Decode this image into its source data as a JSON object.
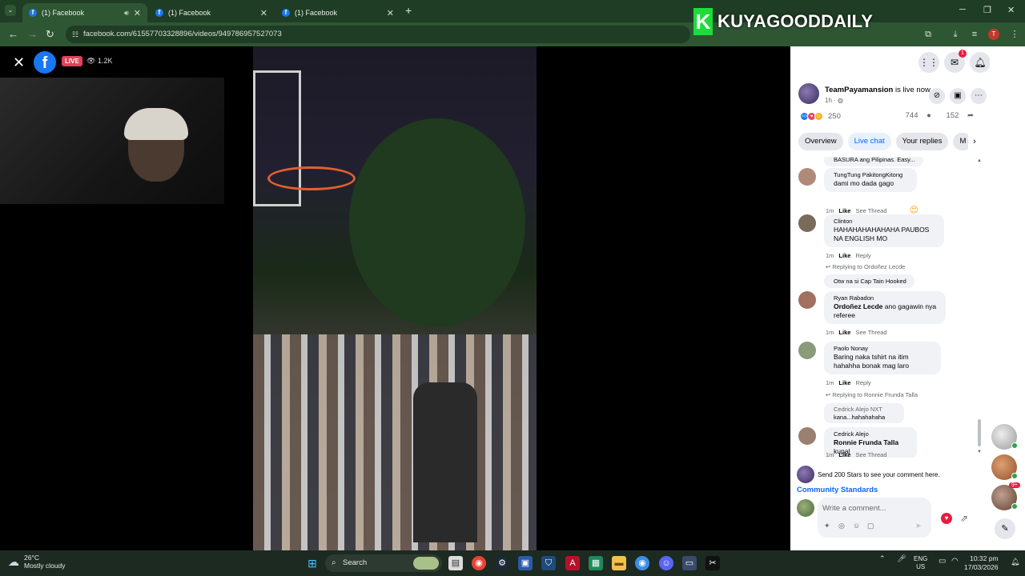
{
  "browser": {
    "tabs": [
      {
        "title": "(1) Facebook",
        "active": true
      },
      {
        "title": "(1) Facebook",
        "active": false
      },
      {
        "title": "(1) Facebook",
        "active": false
      }
    ],
    "new_tab": "+",
    "url": "facebook.com/61557703328896/videos/949786957527073"
  },
  "watermark": {
    "letter": "K",
    "text": "KUYAGOODDAILY"
  },
  "viewer": {
    "live_label": "LIVE",
    "viewer_count": "1.2K"
  },
  "post": {
    "author": "TeamPayamansion",
    "status": "is live now.",
    "time": "1h ·",
    "reaction_count": "250",
    "comment_count": "744",
    "share_count": "152"
  },
  "tabs": {
    "overview": "Overview",
    "live_chat": "Live chat",
    "your_replies": "Your replies",
    "more": "M"
  },
  "chat": {
    "truncated_top": "BASURA ang Pilipinas. Easy...",
    "comments": [
      {
        "author": "TungTung PakitongKitong",
        "text": "dami mo dada gago",
        "time": "1m",
        "like": "Like",
        "action": "See Thread",
        "avatar_color": "#b08a78"
      },
      {
        "author": "Clinton",
        "text": "HAHAHAHAHAHAHA PAUBOS NA ENGLISH MO",
        "time": "1m",
        "like": "Like",
        "action": "Reply",
        "avatar_color": "#7a6a5a"
      },
      {
        "author": "Ryan Rabadon",
        "mention": "Ordoñez Lecde",
        "text": " ano gagawin nya referee",
        "time": "1m",
        "like": "Like",
        "action": "See Thread",
        "avatar_color": "#a07060"
      },
      {
        "author": "Paolo Nonay",
        "text": "Baring naka tshirt na itim hahahha bonak mag laro",
        "time": "1m",
        "like": "Like",
        "action": "Reply",
        "avatar_color": "#8a9a7a"
      },
      {
        "author": "Cedrick Alejo",
        "mention": "Ronnie Frunda Talla",
        "text": " kupal",
        "time": "1m",
        "like": "Like",
        "action": "See Thread",
        "avatar_color": "#9a8070"
      }
    ],
    "reply_1": "Replying to Ordoñez Lecde",
    "reply_1_preview": "Otw na si Cap Tain Hooked",
    "reply_2": "Replying to Ronnie Frunda Talla",
    "reply_2_author": "Cedrick Alejo NXT",
    "reply_2_preview": "kana...hahahahaha"
  },
  "footer": {
    "stars_prompt": "Send 200 Stars to see your comment here.",
    "community": "Community Standards",
    "comment_placeholder": "Write a comment..."
  },
  "contacts": {
    "badge": "9+"
  },
  "taskbar": {
    "temp": "26°C",
    "weather": "Mostly cloudy",
    "search": "Search",
    "lang_1": "ENG",
    "lang_2": "US",
    "time": "10:32 pm",
    "date": "17/03/2026"
  },
  "colors": {
    "accent": "#0866ff",
    "chrome_dark": "#1f3d24",
    "chrome": "#2e5633",
    "live_red": "#e4405a"
  }
}
